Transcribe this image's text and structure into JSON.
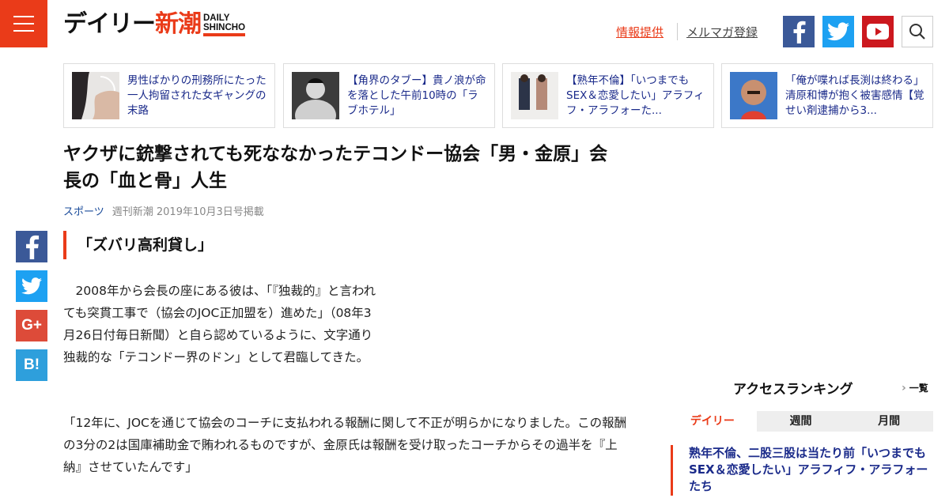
{
  "brand": {
    "logo_jp_black": "デイリー",
    "logo_jp_red": "新潮",
    "logo_en_1": "DAILY",
    "logo_en_2": "SHINCHO"
  },
  "header": {
    "links": [
      {
        "label": "情報提供"
      },
      {
        "label": "メルマガ登録"
      }
    ],
    "icons": [
      "menu-icon",
      "facebook-icon",
      "twitter-icon",
      "youtube-icon",
      "search-icon"
    ]
  },
  "related": [
    {
      "text": "男性ばかりの刑務所にたった一人拘留された女ギャングの末路"
    },
    {
      "text": "【角界のタブー】貴ノ浪が命を落とした午前10時の「ラブホテル」"
    },
    {
      "text": "【熟年不倫】「いつまでもSEX＆恋愛したい」アラフィフ・アラフォーた..."
    },
    {
      "text": "「俺が喋れば長渕は終わる」清原和博が抱く被害感情【覚せい剤逮捕から3..."
    }
  ],
  "article": {
    "title": "ヤクザに銃撃されても死ななかったテコンドー協会「男・金原」会長の「血と骨」人生",
    "category": "スポーツ",
    "source": "週刊新潮 2019年10月3日号掲載",
    "subheading": "「ズバリ高利貸し」",
    "para1": "　2008年から会長の座にある彼は、「『独裁的』と言われても突貫工事で（協会のJOC正加盟を）進めた」（08年3月26日付毎日新聞）と自ら認めているように、文字通り独裁的な「テコンドー界のドン」として君臨してきた。",
    "para2": "「12年に、JOCを通じて協会のコーチに支払われる報酬に関して不正が明らかになりました。この報酬の3分の2は国庫補助金で賄われるものですが、金原氏は報酬を受け取ったコーチからその過半を『上納』させていたんです」"
  },
  "share": {
    "fb": "f",
    "tw": "",
    "gp": "G+",
    "hb": "B!"
  },
  "ranking": {
    "title": "アクセスランキング",
    "all_label": "一覧",
    "tabs": [
      {
        "label": "デイリー"
      },
      {
        "label": "週間"
      },
      {
        "label": "月間"
      }
    ],
    "active_tab": "デイリー",
    "first_item": "熟年不倫、二股三股は当たり前「いつまでもSEX＆恋愛したい」アラフィフ・アラフォーたち"
  },
  "colors": {
    "accent": "#ea3b19",
    "link": "#1a2a8a",
    "facebook": "#3b5998",
    "twitter": "#1da1f2",
    "youtube": "#cc181e",
    "hatena": "#2e9fdc",
    "gplus": "#dd4b39"
  }
}
